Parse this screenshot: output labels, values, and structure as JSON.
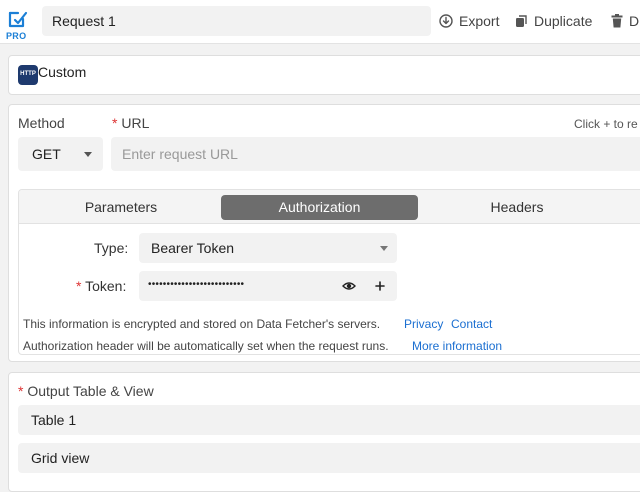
{
  "header": {
    "badge": "PRO",
    "request_name": "Request 1",
    "export_label": "Export",
    "duplicate_label": "Duplicate",
    "delete_label": "D"
  },
  "source": {
    "icon_text": "HTTP",
    "title": "Custom"
  },
  "request": {
    "method_label": "Method",
    "method_value": "GET",
    "url_label": "URL",
    "url_placeholder": "Enter request URL",
    "hint": "Click + to re"
  },
  "tabs": {
    "parameters": "Parameters",
    "authorization": "Authorization",
    "headers": "Headers"
  },
  "auth": {
    "type_label": "Type:",
    "type_value": "Bearer Token",
    "token_label": "Token:",
    "token_mask": "••••••••••••••••••••••••••",
    "note_encrypted": "This information is encrypted and stored on Data Fetcher's servers.",
    "privacy_link": "Privacy",
    "contact_link": "Contact",
    "note_header": "Authorization header will be automatically set when the request runs.",
    "more_link": "More information"
  },
  "output": {
    "label": "Output Table & View",
    "table_value": "Table 1",
    "view_value": "Grid view"
  },
  "colors": {
    "accent": "#1b7fd6",
    "link": "#1b6fd1",
    "required": "#d33333",
    "active_tab": "#6d6d6d"
  }
}
